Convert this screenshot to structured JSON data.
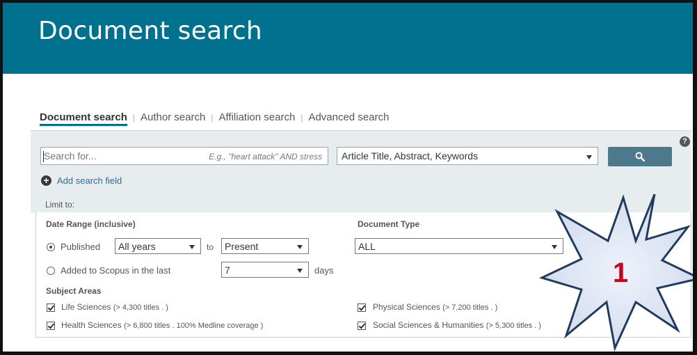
{
  "header": {
    "title": "Document search"
  },
  "tabs": [
    {
      "label": "Document search",
      "active": true
    },
    {
      "label": "Author search",
      "active": false
    },
    {
      "label": "Affiliation search",
      "active": false
    },
    {
      "label": "Advanced search",
      "active": false
    }
  ],
  "search": {
    "placeholder": "Search for...",
    "hint": "E.g., \"heart attack\" AND stress",
    "field_value": "Article Title, Abstract, Keywords",
    "help_label": "?",
    "add_field_label": "Add search field"
  },
  "limits": {
    "limit_label": "Limit to:",
    "date_range_label": "Date Range (inclusive)",
    "published_label": "Published",
    "from_value": "All years",
    "to_label": "to",
    "to_value": "Present",
    "added_label": "Added to Scopus in the last",
    "days_value": "7",
    "days_label": "days",
    "doc_type_label": "Document Type",
    "doc_type_value": "ALL",
    "subject_label": "Subject Areas",
    "subjects": [
      {
        "name": "Life Sciences",
        "note": "(> 4,300 titles . )",
        "checked": true
      },
      {
        "name": "Health Sciences",
        "note": "(> 6,800 titles . 100% Medline coverage )",
        "checked": true
      },
      {
        "name": "Physical Sciences",
        "note": "(> 7,200 titles . )",
        "checked": true
      },
      {
        "name": "Social Sciences & Humanities",
        "note": "(> 5,300 titles . )",
        "checked": true
      }
    ]
  },
  "annotation": {
    "number": "1"
  },
  "colors": {
    "header": "#00718f",
    "panel": "#e7ecef",
    "button": "#4c7a8c",
    "callout_fill": "#dfe6f5",
    "callout_stroke": "#1f3b60",
    "callout_text": "#d0021b"
  },
  "icons": {
    "search": "search-icon",
    "add": "plus-circle-icon",
    "help": "help-icon"
  }
}
